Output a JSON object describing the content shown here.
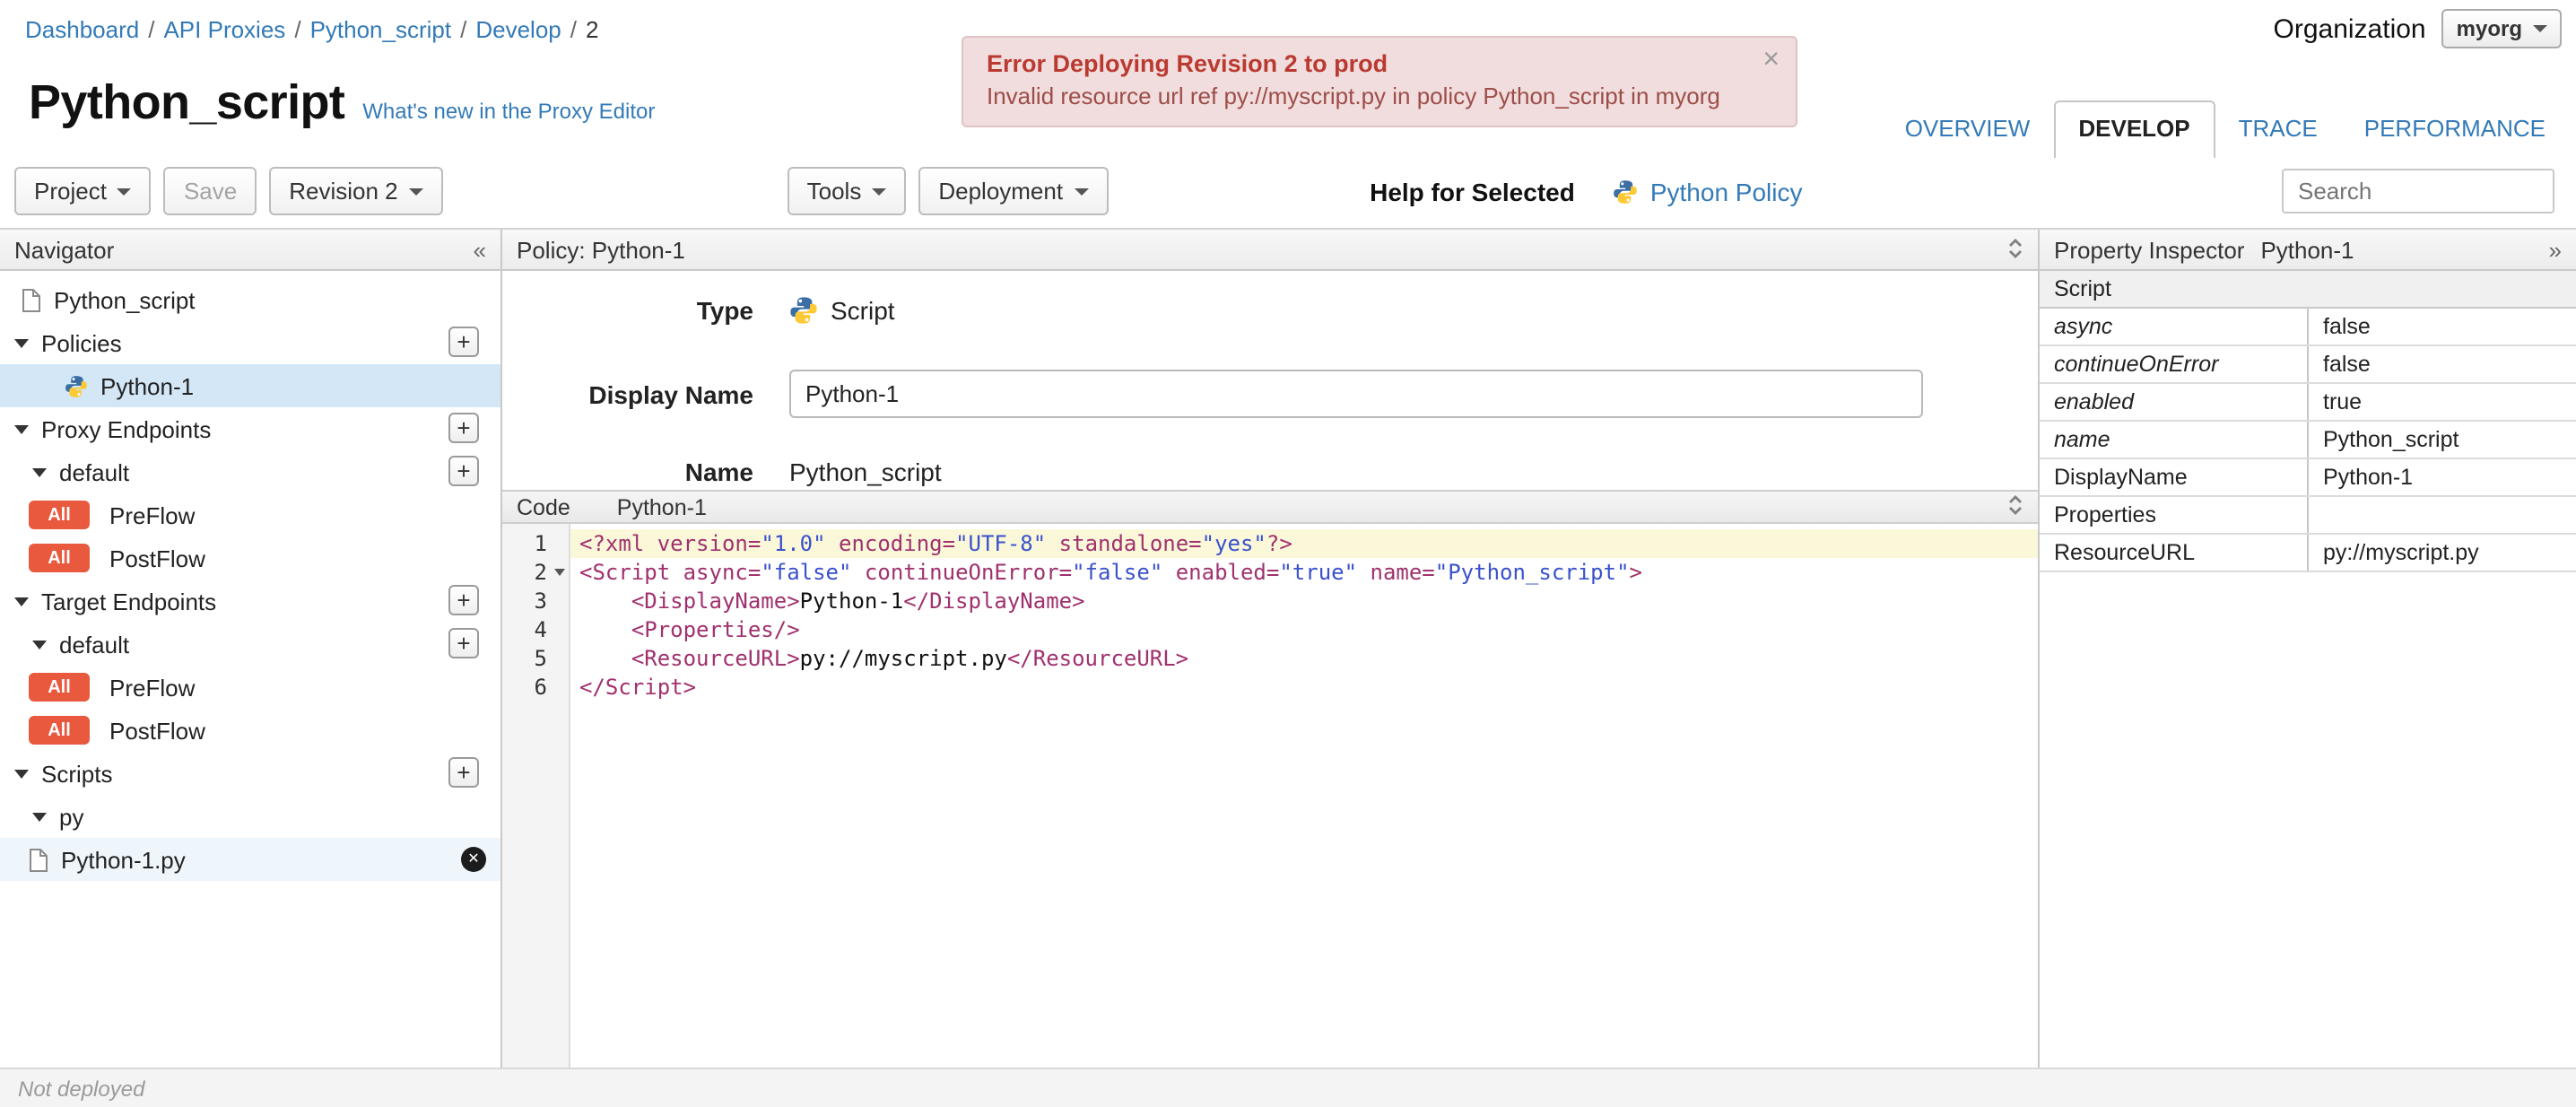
{
  "icons": {
    "collapse_left": "«",
    "expand_right": "»",
    "close": "×",
    "delete": "✕",
    "plus": "+"
  },
  "breadcrumb": {
    "separator": "/",
    "items": [
      "Dashboard",
      "API Proxies",
      "Python_script",
      "Develop",
      "2"
    ]
  },
  "organization": {
    "label": "Organization",
    "value": "myorg"
  },
  "error_banner": {
    "title": "Error Deploying Revision 2 to prod",
    "message": "Invalid resource url ref py://myscript.py in policy Python_script in myorg"
  },
  "page": {
    "title": "Python_script",
    "whats_new_link": "What's new in the Proxy Editor"
  },
  "tabs": [
    {
      "label": "OVERVIEW",
      "active": false
    },
    {
      "label": "DEVELOP",
      "active": true
    },
    {
      "label": "TRACE",
      "active": false
    },
    {
      "label": "PERFORMANCE",
      "active": false
    }
  ],
  "toolbar": {
    "project": "Project",
    "save": "Save",
    "revision": "Revision 2",
    "tools": "Tools",
    "deployment": "Deployment",
    "help_for_selected": "Help for Selected",
    "policy_link": "Python Policy",
    "search_placeholder": "Search"
  },
  "navigator": {
    "title": "Navigator",
    "root_item": "Python_script",
    "policies_label": "Policies",
    "policy_item": "Python-1",
    "proxy_endpoints_label": "Proxy Endpoints",
    "target_endpoints_label": "Target Endpoints",
    "default_label": "default",
    "all_badge": "All",
    "preflow_label": "PreFlow",
    "postflow_label": "PostFlow",
    "scripts_label": "Scripts",
    "py_folder_label": "py",
    "script_file": "Python-1.py"
  },
  "policy_panel": {
    "header": "Policy: Python-1",
    "type_label": "Type",
    "type_value": "Script",
    "display_name_label": "Display Name",
    "display_name_value": "Python-1",
    "name_label": "Name",
    "name_value": "Python_script",
    "code_label": "Code",
    "code_file": "Python-1"
  },
  "code": {
    "lines": [
      {
        "n": "1",
        "highlight": true,
        "tokens": [
          {
            "c": "tag",
            "t": "<?xml version="
          },
          {
            "c": "str",
            "t": "\"1.0\""
          },
          {
            "c": "tag",
            "t": " encoding="
          },
          {
            "c": "str",
            "t": "\"UTF-8\""
          },
          {
            "c": "tag",
            "t": " standalone="
          },
          {
            "c": "str",
            "t": "\"yes\""
          },
          {
            "c": "tag",
            "t": "?>"
          }
        ]
      },
      {
        "n": "2",
        "fold": true,
        "tokens": [
          {
            "c": "tag",
            "t": "<Script async="
          },
          {
            "c": "str",
            "t": "\"false\""
          },
          {
            "c": "tag",
            "t": " continueOnError="
          },
          {
            "c": "str",
            "t": "\"false\""
          },
          {
            "c": "tag",
            "t": " enabled="
          },
          {
            "c": "str",
            "t": "\"true\""
          },
          {
            "c": "tag",
            "t": " name="
          },
          {
            "c": "str",
            "t": "\"Python_script\""
          },
          {
            "c": "tag",
            "t": ">"
          }
        ]
      },
      {
        "n": "3",
        "tokens": [
          {
            "c": "plain",
            "t": "    "
          },
          {
            "c": "tag",
            "t": "<DisplayName>"
          },
          {
            "c": "plain",
            "t": "Python-1"
          },
          {
            "c": "tag",
            "t": "</DisplayName>"
          }
        ]
      },
      {
        "n": "4",
        "tokens": [
          {
            "c": "plain",
            "t": "    "
          },
          {
            "c": "tag",
            "t": "<Properties/>"
          }
        ]
      },
      {
        "n": "5",
        "tokens": [
          {
            "c": "plain",
            "t": "    "
          },
          {
            "c": "tag",
            "t": "<ResourceURL>"
          },
          {
            "c": "plain",
            "t": "py://myscript.py"
          },
          {
            "c": "tag",
            "t": "</ResourceURL>"
          }
        ]
      },
      {
        "n": "6",
        "tokens": [
          {
            "c": "tag",
            "t": "</Script>"
          }
        ]
      }
    ]
  },
  "property_inspector": {
    "title": "Property Inspector",
    "subtitle": "Python-1",
    "section_header": "Script",
    "rows": [
      {
        "key": "async",
        "value": "false",
        "italic": true
      },
      {
        "key": "continueOnError",
        "value": "false",
        "italic": true
      },
      {
        "key": "enabled",
        "value": "true",
        "italic": true
      },
      {
        "key": "name",
        "value": "Python_script",
        "italic": true
      },
      {
        "key": "DisplayName",
        "value": "Python-1",
        "italic": false
      },
      {
        "key": "Properties",
        "value": "",
        "italic": false
      },
      {
        "key": "ResourceURL",
        "value": "py://myscript.py",
        "italic": false
      }
    ]
  },
  "status_bar": {
    "text": "Not deployed"
  }
}
